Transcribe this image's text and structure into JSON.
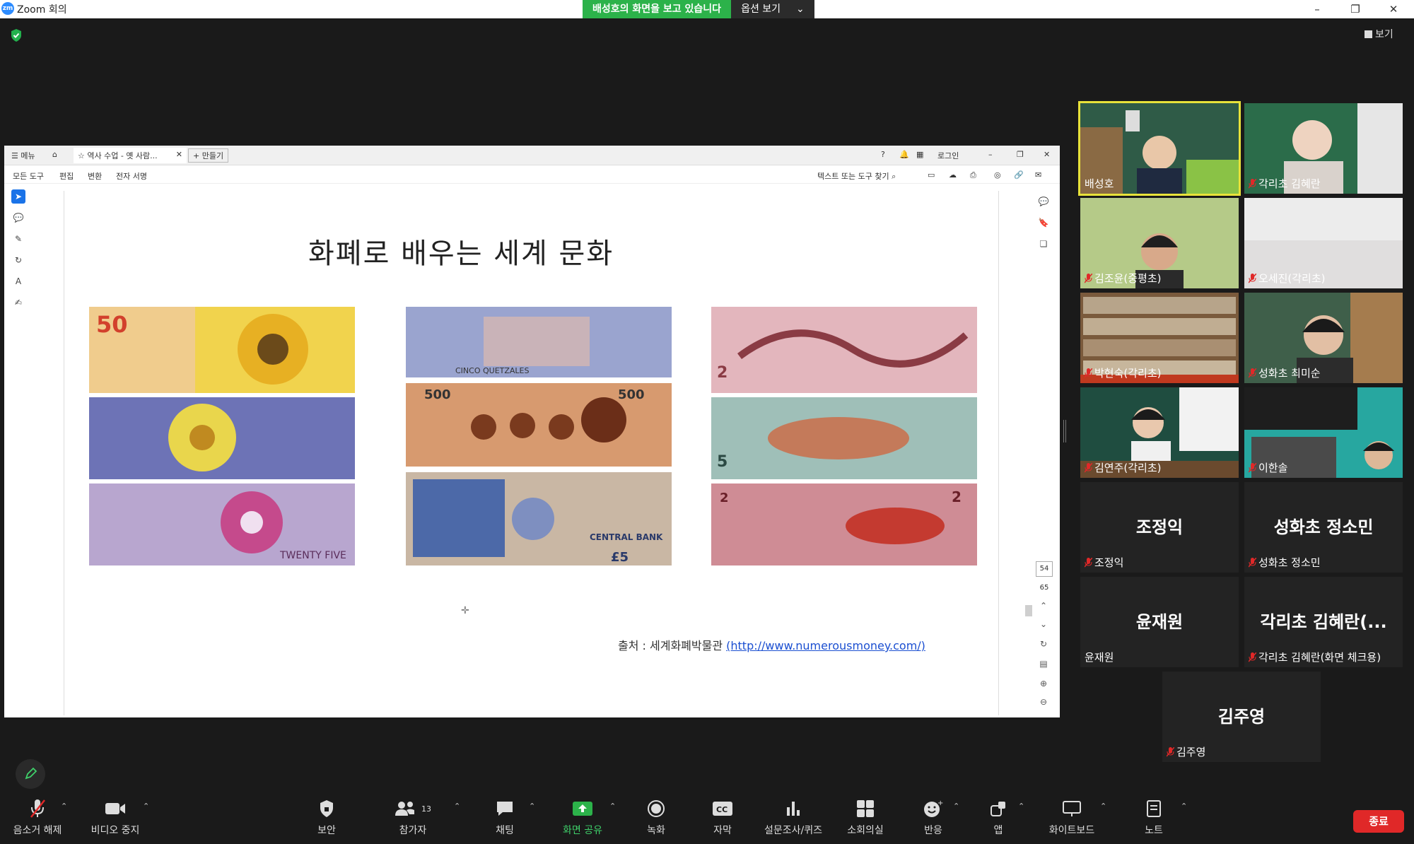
{
  "app": {
    "logo": "zm",
    "title": "Zoom 회의"
  },
  "banner": {
    "message": "배성호의 화면을 보고 있습니다",
    "options": "옵션 보기"
  },
  "view": {
    "label": "보기"
  },
  "document": {
    "tabs": {
      "menu": "메뉴",
      "tab_title": "역사 수업 - 옛 사람...",
      "new": "+ 만들기",
      "login": "로그인"
    },
    "menu": {
      "all_tools": "모든 도구",
      "edit": "편집",
      "convert": "변환",
      "esign": "전자 서명",
      "search": "텍스트 또는 도구 찾기"
    },
    "slide": {
      "title": "화폐로 배우는 세계 문화",
      "source_prefix": "출처 : 세계화폐박물관 ",
      "source_link": "(http://www.numerousmoney.com/)"
    },
    "page": {
      "current": "54",
      "total": "65"
    }
  },
  "participants": [
    {
      "name": "배성호",
      "muted": false,
      "video": true,
      "active": true
    },
    {
      "name": "각리초 김혜란",
      "muted": true,
      "video": true
    },
    {
      "name": "김조윤(중평초)",
      "muted": true,
      "video": true
    },
    {
      "name": "오세진(각리초)",
      "muted": true,
      "video": true
    },
    {
      "name": "박현숙(각리초)",
      "muted": true,
      "video": true
    },
    {
      "name": "성화초 최미순",
      "muted": true,
      "video": true
    },
    {
      "name": "김연주(각리초)",
      "muted": true,
      "video": true
    },
    {
      "name": "이한솔",
      "muted": true,
      "video": true
    },
    {
      "name": "조정익",
      "display": "조정익",
      "muted": true,
      "video": false
    },
    {
      "name": "성화초 정소민",
      "display": "성화초 정소민",
      "muted": true,
      "video": false
    },
    {
      "name": "윤재원",
      "display": "윤재원",
      "muted": false,
      "video": false
    },
    {
      "name": "각리초 김혜란(화면 체크용)",
      "display": "각리초 김혜란(...",
      "muted": true,
      "video": false
    },
    {
      "name": "김주영",
      "display": "김주영",
      "muted": true,
      "video": false
    }
  ],
  "toolbar": {
    "unmute": "음소거 해제",
    "stop_video": "비디오 중지",
    "security": "보안",
    "participants": "참가자",
    "participants_count": "13",
    "chat": "채팅",
    "share": "화면 공유",
    "record": "녹화",
    "captions": "자막",
    "polls": "설문조사/퀴즈",
    "breakout": "소회의실",
    "reactions": "반응",
    "apps": "앱",
    "whiteboard": "화이트보드",
    "notes": "노트",
    "end": "종료"
  },
  "colors": {
    "accent_green": "#2cb24a",
    "end_red": "#e02828",
    "active_speaker": "#e8e23a",
    "muted_red": "#e02828"
  }
}
